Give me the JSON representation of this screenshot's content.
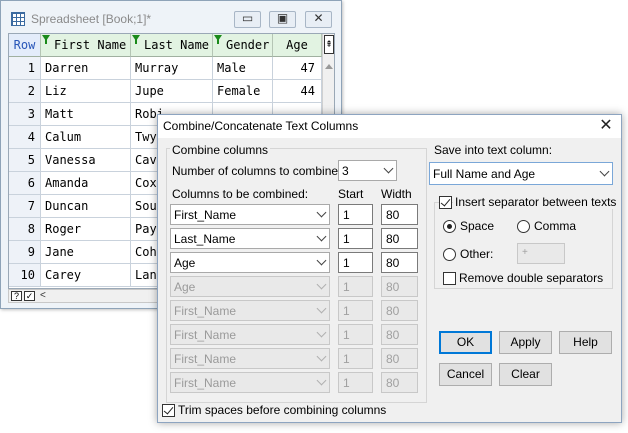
{
  "spreadsheet": {
    "title": "Spreadsheet [Book;1]*",
    "row_header": "Row",
    "columns": [
      "First Name",
      "Last Name",
      "Gender",
      "Age"
    ],
    "rows": [
      {
        "n": "1",
        "first": "Darren",
        "last": "Murray",
        "gender": "Male",
        "age": "47"
      },
      {
        "n": "2",
        "first": "Liz",
        "last": "Jupe",
        "gender": "Female",
        "age": "44"
      },
      {
        "n": "3",
        "first": "Matt",
        "last": "Robi",
        "gender": "",
        "age": ""
      },
      {
        "n": "4",
        "first": "Calum",
        "last": "Twy",
        "gender": "",
        "age": ""
      },
      {
        "n": "5",
        "first": "Vanessa",
        "last": "Cav",
        "gender": "",
        "age": ""
      },
      {
        "n": "6",
        "first": "Amanda",
        "last": "Cox",
        "gender": "",
        "age": ""
      },
      {
        "n": "7",
        "first": "Duncan",
        "last": "Sou",
        "gender": "",
        "age": ""
      },
      {
        "n": "8",
        "first": "Roger",
        "last": "Pay",
        "gender": "",
        "age": ""
      },
      {
        "n": "9",
        "first": "Jane",
        "last": "Coh",
        "gender": "",
        "age": ""
      },
      {
        "n": "10",
        "first": "Carey",
        "last": "Lan",
        "gender": "",
        "age": ""
      }
    ],
    "status_help": "?",
    "status_check": "✓",
    "status_left": "<"
  },
  "dialog": {
    "title": "Combine/Concatenate Text Columns",
    "close_glyph": "✕",
    "combine_group_label": "Combine columns",
    "num_columns_label": "Number of columns to combine:",
    "num_columns_value": "3",
    "columns_label": "Columns to be combined:",
    "start_label": "Start",
    "width_label": "Width",
    "column_rows": [
      {
        "name": "First_Name",
        "start": "1",
        "width": "80",
        "enabled": true
      },
      {
        "name": "Last_Name",
        "start": "1",
        "width": "80",
        "enabled": true
      },
      {
        "name": "Age",
        "start": "1",
        "width": "80",
        "enabled": true
      },
      {
        "name": "Age",
        "start": "1",
        "width": "80",
        "enabled": false
      },
      {
        "name": "First_Name",
        "start": "1",
        "width": "80",
        "enabled": false
      },
      {
        "name": "First_Name",
        "start": "1",
        "width": "80",
        "enabled": false
      },
      {
        "name": "First_Name",
        "start": "1",
        "width": "80",
        "enabled": false
      },
      {
        "name": "First_Name",
        "start": "1",
        "width": "80",
        "enabled": false
      }
    ],
    "trim_label": "Trim spaces before combining columns",
    "save_into_label": "Save into text column:",
    "save_into_value": "Full Name and Age",
    "insert_sep_label": "Insert separator between texts",
    "space_label": "Space",
    "comma_label": "Comma",
    "other_label": "Other:",
    "other_value": "+",
    "remove_double_label": "Remove double separators",
    "buttons": {
      "ok": "OK",
      "apply": "Apply",
      "help": "Help",
      "cancel": "Cancel",
      "clear": "Clear"
    }
  }
}
